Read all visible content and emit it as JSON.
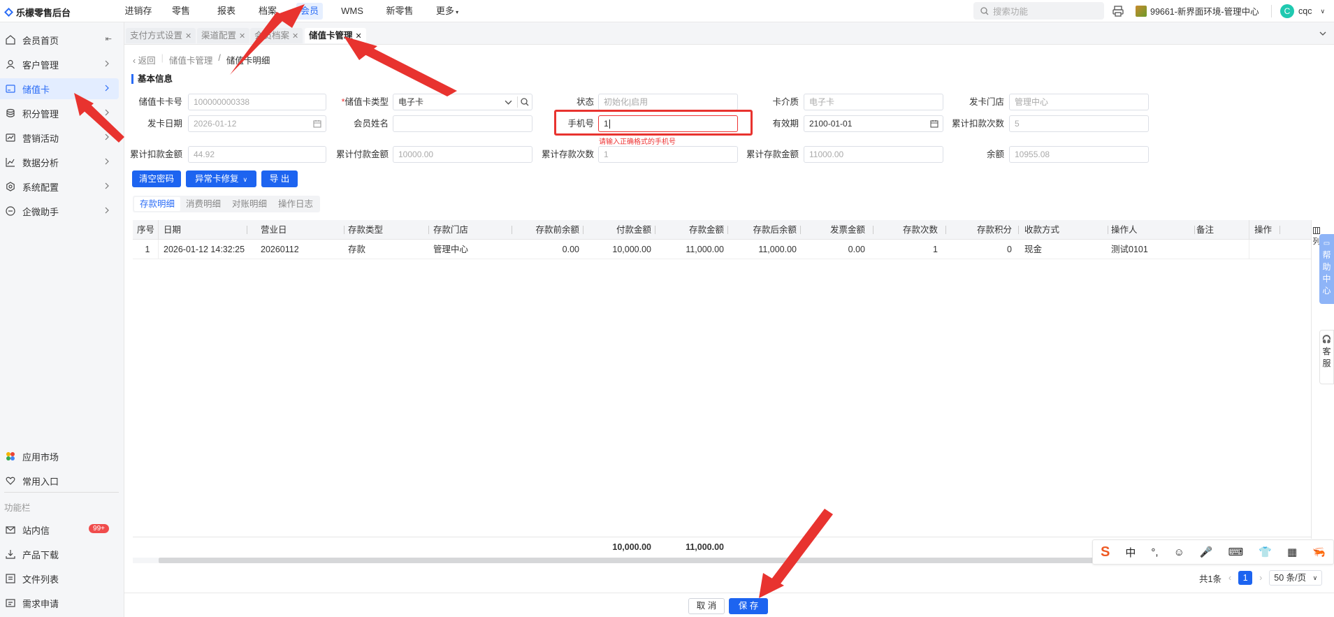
{
  "app": {
    "title": "乐檬零售后台"
  },
  "topnav": {
    "items": [
      "进销存",
      "零售",
      "报表",
      "档案",
      "会员",
      "WMS",
      "新零售",
      "更多"
    ],
    "active": "会员"
  },
  "search": {
    "placeholder": "搜索功能"
  },
  "store": {
    "name": "99661-新界面环境-管理中心"
  },
  "user": {
    "avatar_letter": "C",
    "name": "cqc"
  },
  "sidebar": {
    "items": [
      {
        "label": "会员首页",
        "icon": "home-icon"
      },
      {
        "label": "客户管理",
        "icon": "user-icon"
      },
      {
        "label": "储值卡",
        "icon": "card-icon"
      },
      {
        "label": "积分管理",
        "icon": "coins-icon"
      },
      {
        "label": "营销活动",
        "icon": "campaign-icon"
      },
      {
        "label": "数据分析",
        "icon": "chart-icon"
      },
      {
        "label": "系统配置",
        "icon": "gear-icon"
      },
      {
        "label": "企微助手",
        "icon": "chat-icon"
      }
    ],
    "active": "储值卡",
    "bottom": [
      {
        "label": "应用市场"
      },
      {
        "label": "常用入口"
      }
    ],
    "func_label": "功能栏",
    "func_items": [
      {
        "label": "站内信",
        "badge": "99+"
      },
      {
        "label": "产品下载"
      },
      {
        "label": "文件列表"
      },
      {
        "label": "需求申请"
      }
    ]
  },
  "tabs": [
    {
      "label": "支付方式设置"
    },
    {
      "label": "渠道配置"
    },
    {
      "label": "会员档案"
    },
    {
      "label": "储值卡管理"
    }
  ],
  "breadcrumb": {
    "back": "返回",
    "parent": "储值卡管理",
    "sep": "/",
    "current": "储值卡明细"
  },
  "section_title": "基本信息",
  "form": {
    "card_no": {
      "label": "储值卡卡号",
      "value": "100000000338"
    },
    "card_type": {
      "label": "储值卡类型",
      "value": "电子卡"
    },
    "status": {
      "label": "状态",
      "value": "初始化|启用"
    },
    "medium": {
      "label": "卡介质",
      "value": "电子卡"
    },
    "issue_store": {
      "label": "发卡门店",
      "value": "管理中心"
    },
    "issue_date": {
      "label": "发卡日期",
      "value": "2026-01-12"
    },
    "member_name": {
      "label": "会员姓名",
      "value": ""
    },
    "phone": {
      "label": "手机号",
      "value": "1",
      "error": "请输入正确格式的手机号"
    },
    "expiry": {
      "label": "有效期",
      "value": "2100-01-01"
    },
    "deduct_count": {
      "label": "累计扣款次数",
      "value": "5"
    },
    "deduct_amount": {
      "label": "累计扣款金额",
      "value": "44.92"
    },
    "pay_amount": {
      "label": "累计付款金额",
      "value": "10000.00"
    },
    "deposit_count": {
      "label": "累计存款次数",
      "value": "1"
    },
    "deposit_amount": {
      "label": "累计存款金额",
      "value": "11000.00"
    },
    "balance": {
      "label": "余额",
      "value": "10955.08"
    }
  },
  "actions": {
    "clear_pwd": "清空密码",
    "fix_card": "异常卡修复",
    "export": "导 出"
  },
  "subtabs": [
    "存款明细",
    "消费明细",
    "对账明细",
    "操作日志"
  ],
  "table": {
    "headers": [
      "序号",
      "日期",
      "营业日",
      "存款类型",
      "存款门店",
      "存款前余额",
      "付款金额",
      "存款金额",
      "存款后余额",
      "发票金额",
      "存款次数",
      "存款积分",
      "收款方式",
      "操作人",
      "备注",
      "操作"
    ],
    "rows": [
      [
        "1",
        "2026-01-12 14:32:25",
        "20260112",
        "存款",
        "管理中心",
        "0.00",
        "10,000.00",
        "11,000.00",
        "11,000.00",
        "0.00",
        "1",
        "0",
        "现金",
        "测试0101",
        "",
        ""
      ]
    ],
    "footer": {
      "pay_total": "10,000.00",
      "deposit_total": "11,000.00"
    },
    "col_ctl": "列"
  },
  "right_float": {
    "help": "帮助中心",
    "service": "客服"
  },
  "ime": [
    "S",
    "中",
    "°,",
    "☺",
    "🎤",
    "⌨",
    "👕",
    "▦",
    "🦐"
  ],
  "pager": {
    "total": "共1条",
    "page": "1",
    "size": "50 条/页"
  },
  "bottom_buttons": {
    "cancel": "取 消",
    "save": "保 存"
  }
}
